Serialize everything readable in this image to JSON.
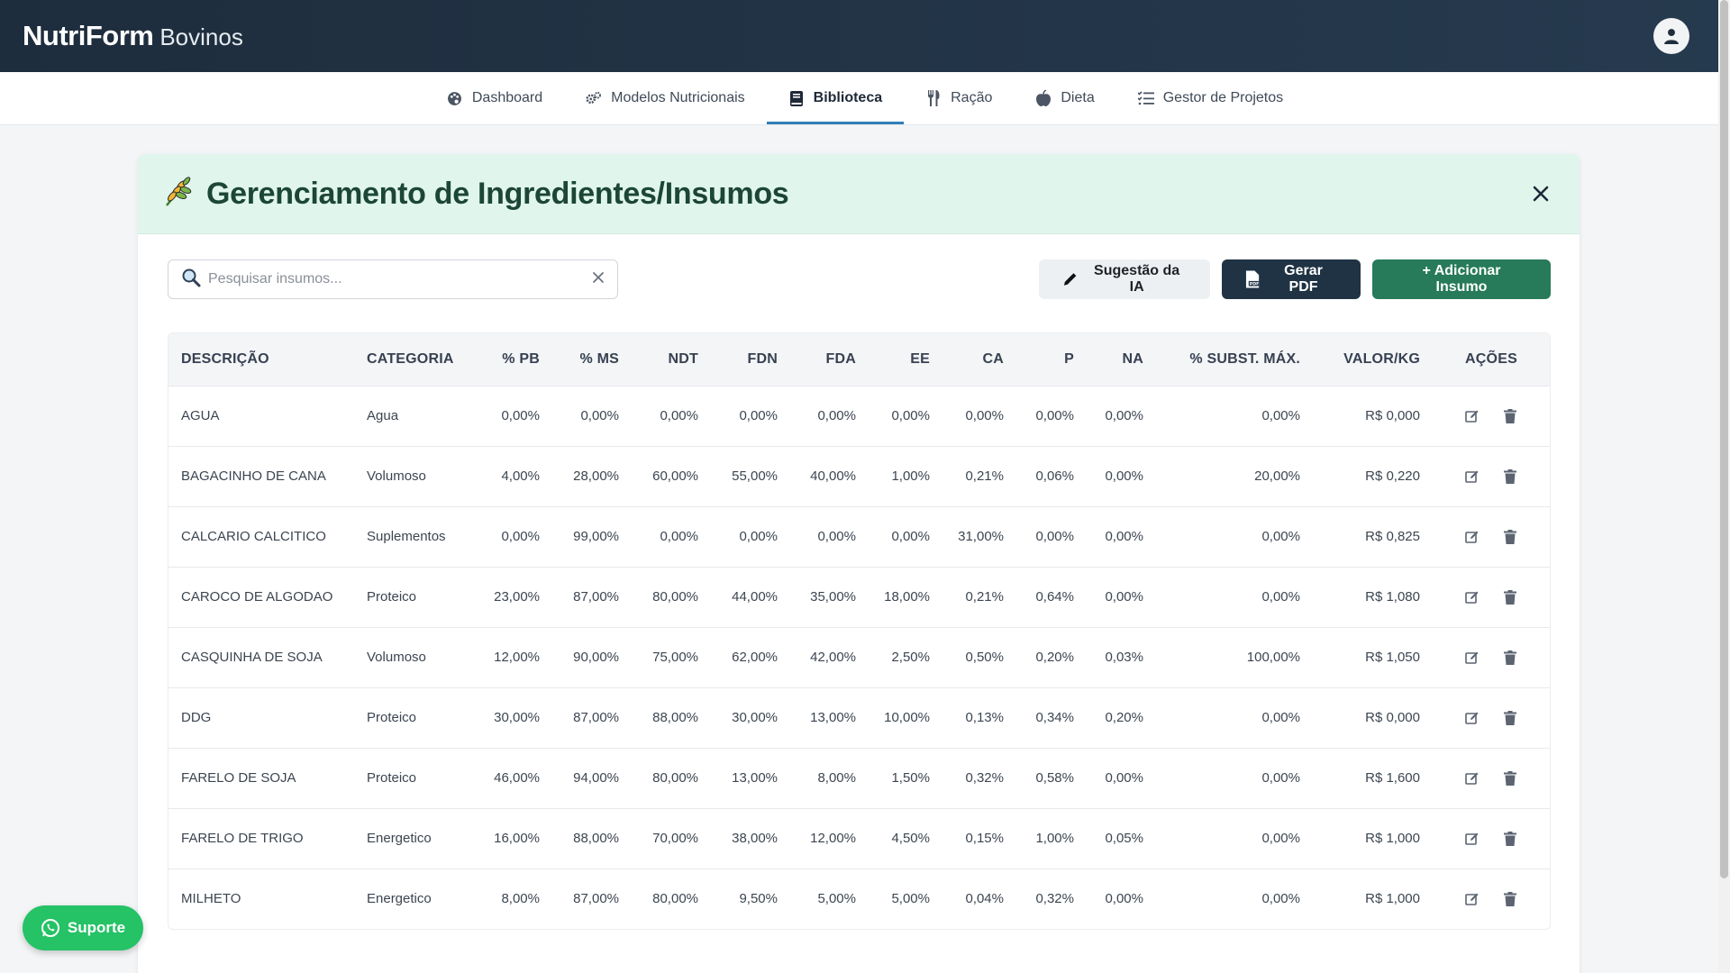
{
  "header": {
    "brand_strong": "NutriForm",
    "brand_light": "Bovinos"
  },
  "nav": [
    {
      "label": "Dashboard",
      "icon": "palette-icon"
    },
    {
      "label": "Modelos Nutricionais",
      "icon": "gears-icon"
    },
    {
      "label": "Biblioteca",
      "icon": "book-icon",
      "active": true
    },
    {
      "label": "Ração",
      "icon": "utensils-icon"
    },
    {
      "label": "Dieta",
      "icon": "apple-icon"
    },
    {
      "label": "Gestor de Projetos",
      "icon": "list-check-icon"
    }
  ],
  "card": {
    "title": "Gerenciamento de Ingredientes/Insumos"
  },
  "search": {
    "placeholder": "Pesquisar insumos..."
  },
  "buttons": {
    "ia": "Sugestão da IA",
    "pdf": "Gerar PDF",
    "add": "+ Adicionar Insumo"
  },
  "table": {
    "headers": [
      "DESCRIÇÃO",
      "CATEGORIA",
      "% PB",
      "% MS",
      "NDT",
      "FDN",
      "FDA",
      "EE",
      "CA",
      "P",
      "NA",
      "% SUBST. MÁX.",
      "VALOR/KG",
      "AÇÕES"
    ],
    "rows": [
      [
        "AGUA",
        "Agua",
        "0,00%",
        "0,00%",
        "0,00%",
        "0,00%",
        "0,00%",
        "0,00%",
        "0,00%",
        "0,00%",
        "0,00%",
        "0,00%",
        "R$ 0,000"
      ],
      [
        "BAGACINHO DE CANA",
        "Volumoso",
        "4,00%",
        "28,00%",
        "60,00%",
        "55,00%",
        "40,00%",
        "1,00%",
        "0,21%",
        "0,06%",
        "0,00%",
        "20,00%",
        "R$ 0,220"
      ],
      [
        "CALCARIO CALCITICO",
        "Suplementos",
        "0,00%",
        "99,00%",
        "0,00%",
        "0,00%",
        "0,00%",
        "0,00%",
        "31,00%",
        "0,00%",
        "0,00%",
        "0,00%",
        "R$ 0,825"
      ],
      [
        "CAROCO DE ALGODAO",
        "Proteico",
        "23,00%",
        "87,00%",
        "80,00%",
        "44,00%",
        "35,00%",
        "18,00%",
        "0,21%",
        "0,64%",
        "0,00%",
        "0,00%",
        "R$ 1,080"
      ],
      [
        "CASQUINHA DE SOJA",
        "Volumoso",
        "12,00%",
        "90,00%",
        "75,00%",
        "62,00%",
        "42,00%",
        "2,50%",
        "0,50%",
        "0,20%",
        "0,03%",
        "100,00%",
        "R$ 1,050"
      ],
      [
        "DDG",
        "Proteico",
        "30,00%",
        "87,00%",
        "88,00%",
        "30,00%",
        "13,00%",
        "10,00%",
        "0,13%",
        "0,34%",
        "0,20%",
        "0,00%",
        "R$ 0,000"
      ],
      [
        "FARELO DE SOJA",
        "Proteico",
        "46,00%",
        "94,00%",
        "80,00%",
        "13,00%",
        "8,00%",
        "1,50%",
        "0,32%",
        "0,58%",
        "0,00%",
        "0,00%",
        "R$ 1,600"
      ],
      [
        "FARELO DE TRIGO",
        "Energetico",
        "16,00%",
        "88,00%",
        "70,00%",
        "38,00%",
        "12,00%",
        "4,50%",
        "0,15%",
        "1,00%",
        "0,05%",
        "0,00%",
        "R$ 1,000"
      ],
      [
        "MILHETO",
        "Energetico",
        "8,00%",
        "87,00%",
        "80,00%",
        "9,50%",
        "5,00%",
        "5,00%",
        "0,04%",
        "0,32%",
        "0,00%",
        "0,00%",
        "R$ 1,000"
      ]
    ]
  },
  "support": {
    "label": "Suporte"
  },
  "colors": {
    "topbar": "#1e2d3d",
    "accent_green": "#277a5a",
    "header_bg": "#e0f5ec",
    "whatsapp": "#25c266"
  }
}
